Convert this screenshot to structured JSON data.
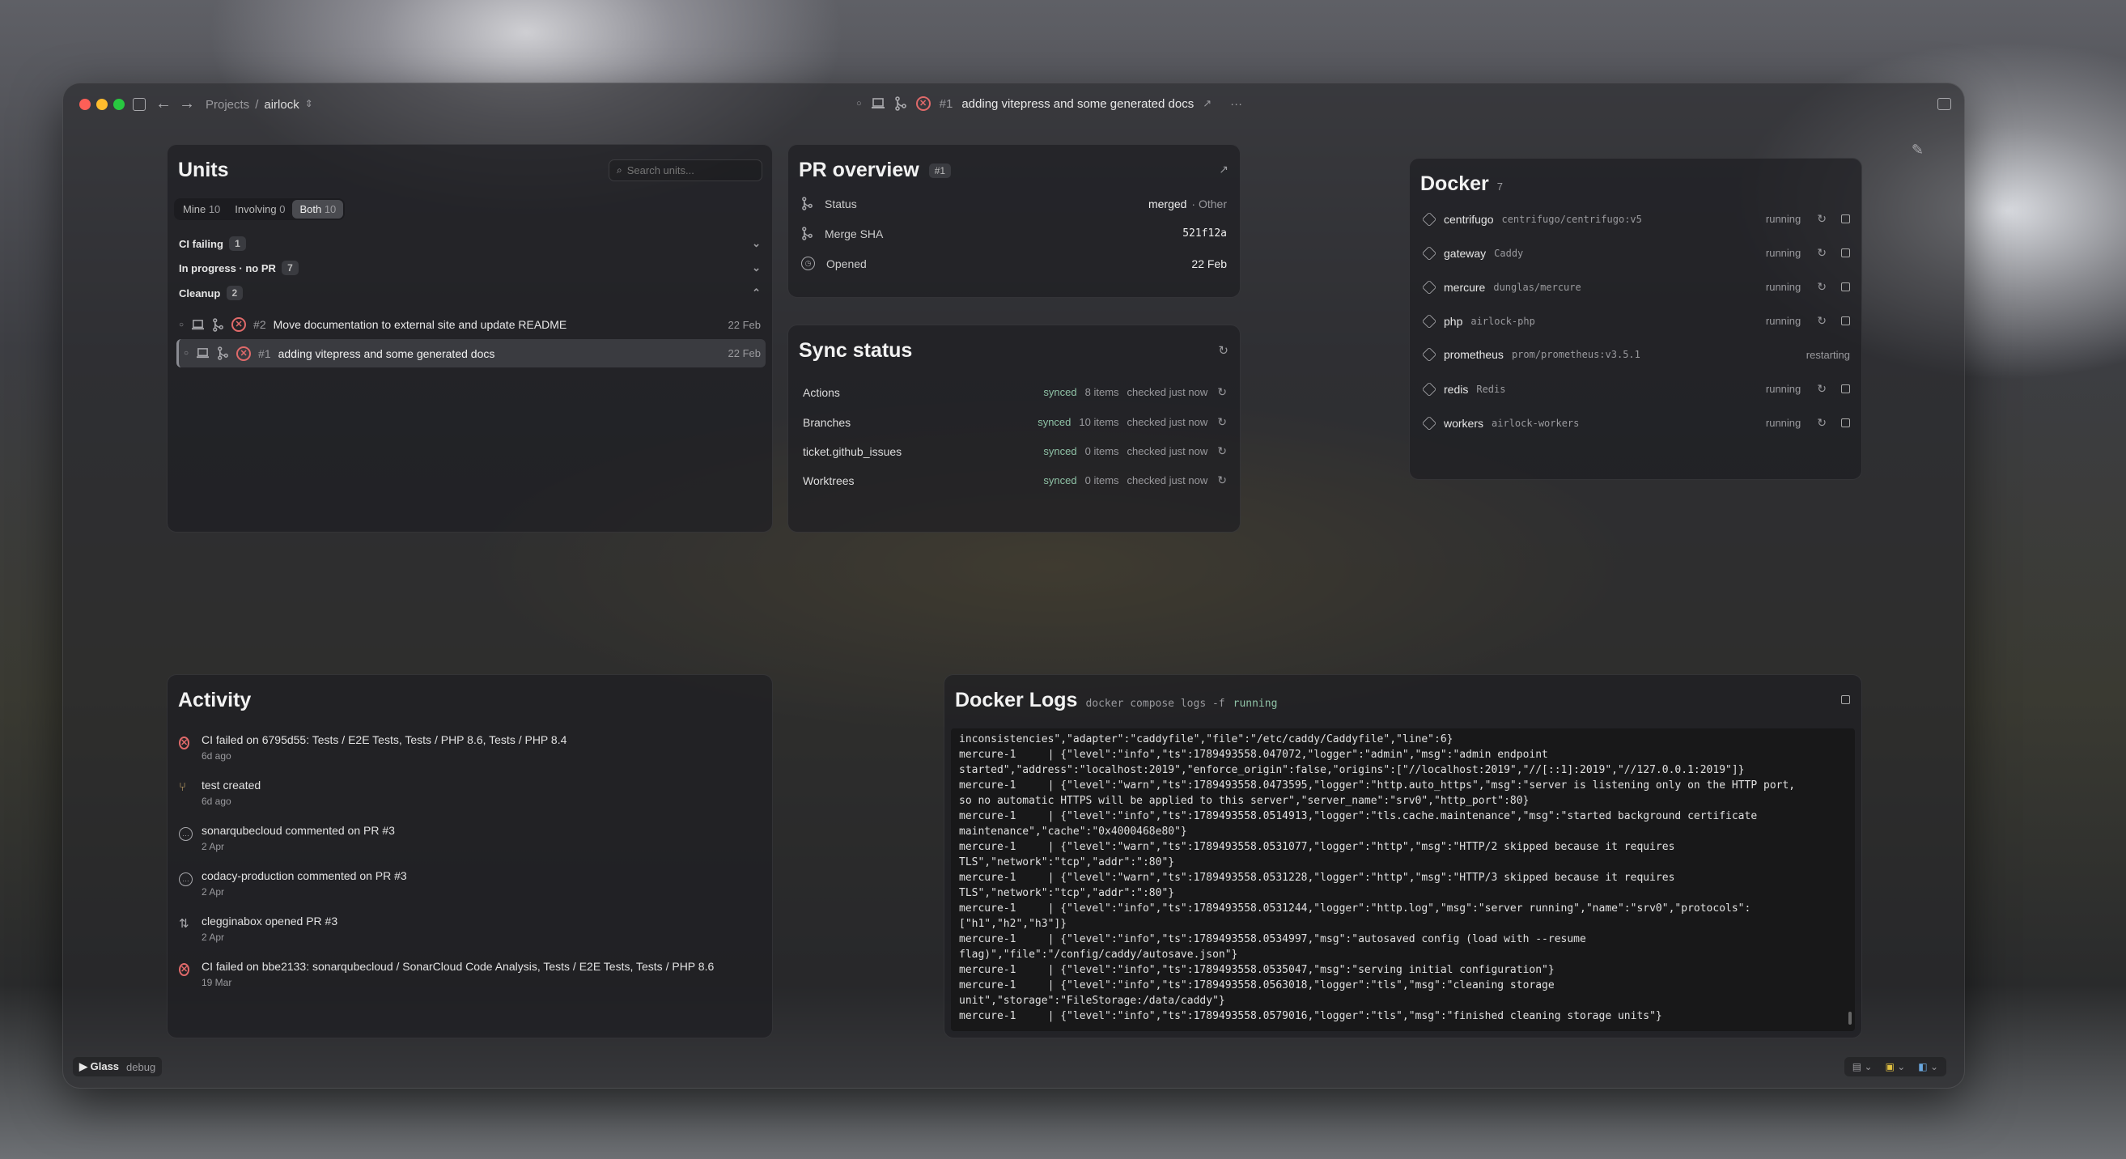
{
  "window": {
    "breadcrumb_root": "Projects",
    "breadcrumb_sep": "/",
    "breadcrumb_project": "airlock",
    "title_pr": "#1",
    "title_text": "adding vitepress and some generated docs"
  },
  "units": {
    "title": "Units",
    "search_placeholder": "Search units...",
    "filters": [
      {
        "label": "Mine",
        "count": "10"
      },
      {
        "label": "Involving",
        "count": "0"
      },
      {
        "label": "Both",
        "count": "10"
      }
    ],
    "groups": [
      {
        "label": "CI failing",
        "count": "1",
        "chevron": "⌄"
      },
      {
        "label": "In progress · no PR",
        "count": "7",
        "chevron": "⌄"
      },
      {
        "label": "Cleanup",
        "count": "2",
        "chevron": "⌃"
      }
    ],
    "items": [
      {
        "num": "#2",
        "title": "Move documentation to external site and update README",
        "date": "22 Feb"
      },
      {
        "num": "#1",
        "title": "adding vitepress and some generated docs",
        "date": "22 Feb"
      }
    ]
  },
  "pr": {
    "title": "PR overview",
    "badge": "#1",
    "rows": [
      {
        "label": "Status",
        "value": "merged",
        "extra": "· Other"
      },
      {
        "label": "Merge SHA",
        "value": "521f12a",
        "extra": ""
      },
      {
        "label": "Opened",
        "value": "22 Feb",
        "extra": ""
      }
    ]
  },
  "sync": {
    "title": "Sync status",
    "rows": [
      {
        "name": "Actions",
        "state": "synced",
        "items": "8 items",
        "checked": "checked just now"
      },
      {
        "name": "Branches",
        "state": "synced",
        "items": "10 items",
        "checked": "checked just now"
      },
      {
        "name": "ticket.github_issues",
        "state": "synced",
        "items": "0 items",
        "checked": "checked just now"
      },
      {
        "name": "Worktrees",
        "state": "synced",
        "items": "0 items",
        "checked": "checked just now"
      }
    ]
  },
  "docker": {
    "title": "Docker",
    "count": "7",
    "containers": [
      {
        "name": "centrifugo",
        "image": "centrifugo/centrifugo:v5",
        "state": "running"
      },
      {
        "name": "gateway",
        "image": "Caddy",
        "state": "running"
      },
      {
        "name": "mercure",
        "image": "dunglas/mercure",
        "state": "running"
      },
      {
        "name": "php",
        "image": "airlock-php",
        "state": "running"
      },
      {
        "name": "prometheus",
        "image": "prom/prometheus:v3.5.1",
        "state": "restarting"
      },
      {
        "name": "redis",
        "image": "Redis",
        "state": "running"
      },
      {
        "name": "workers",
        "image": "airlock-workers",
        "state": "running"
      }
    ]
  },
  "activity": {
    "title": "Activity",
    "items": [
      {
        "icon": "x",
        "text": "CI failed on 6795d55: Tests / E2E Tests, Tests / PHP 8.6, Tests / PHP 8.4",
        "time": "6d ago"
      },
      {
        "icon": "branch",
        "text": "test created",
        "time": "6d ago"
      },
      {
        "icon": "comment",
        "text": "sonarqubecloud commented on PR #3",
        "time": "2 Apr"
      },
      {
        "icon": "comment",
        "text": "codacy-production commented on PR #3",
        "time": "2 Apr"
      },
      {
        "icon": "pr",
        "text": "clegginabox opened PR #3",
        "time": "2 Apr"
      },
      {
        "icon": "x",
        "text": "CI failed on bbe2133: sonarqubecloud / SonarCloud Code Analysis, Tests / E2E Tests, Tests / PHP 8.6",
        "time": "19 Mar"
      }
    ]
  },
  "logs": {
    "title": "Docker Logs",
    "command": "docker compose logs -f",
    "state": "running",
    "lines": [
      "inconsistencies\",\"adapter\":\"caddyfile\",\"file\":\"/etc/caddy/Caddyfile\",\"line\":6}",
      "mercure-1     | {\"level\":\"info\",\"ts\":1789493558.047072,\"logger\":\"admin\",\"msg\":\"admin endpoint",
      "started\",\"address\":\"localhost:2019\",\"enforce_origin\":false,\"origins\":[\"//localhost:2019\",\"//[::1]:2019\",\"//127.0.0.1:2019\"]}",
      "mercure-1     | {\"level\":\"warn\",\"ts\":1789493558.0473595,\"logger\":\"http.auto_https\",\"msg\":\"server is listening only on the HTTP port,",
      "so no automatic HTTPS will be applied to this server\",\"server_name\":\"srv0\",\"http_port\":80}",
      "mercure-1     | {\"level\":\"info\",\"ts\":1789493558.0514913,\"logger\":\"tls.cache.maintenance\",\"msg\":\"started background certificate",
      "maintenance\",\"cache\":\"0x4000468e80\"}",
      "mercure-1     | {\"level\":\"warn\",\"ts\":1789493558.0531077,\"logger\":\"http\",\"msg\":\"HTTP/2 skipped because it requires",
      "TLS\",\"network\":\"tcp\",\"addr\":\":80\"}",
      "mercure-1     | {\"level\":\"warn\",\"ts\":1789493558.0531228,\"logger\":\"http\",\"msg\":\"HTTP/3 skipped because it requires",
      "TLS\",\"network\":\"tcp\",\"addr\":\":80\"}",
      "mercure-1     | {\"level\":\"info\",\"ts\":1789493558.0531244,\"logger\":\"http.log\",\"msg\":\"server running\",\"name\":\"srv0\",\"protocols\":",
      "[\"h1\",\"h2\",\"h3\"]}",
      "mercure-1     | {\"level\":\"info\",\"ts\":1789493558.0534997,\"msg\":\"autosaved config (load with --resume",
      "flag)\",\"file\":\"/config/caddy/autosave.json\"}",
      "mercure-1     | {\"level\":\"info\",\"ts\":1789493558.0535047,\"msg\":\"serving initial configuration\"}",
      "mercure-1     | {\"level\":\"info\",\"ts\":1789493558.0563018,\"logger\":\"tls\",\"msg\":\"cleaning storage",
      "unit\",\"storage\":\"FileStorage:/data/caddy\"}",
      "mercure-1     | {\"level\":\"info\",\"ts\":1789493558.0579016,\"logger\":\"tls\",\"msg\":\"finished cleaning storage units\"}"
    ]
  },
  "footer": {
    "app": "▶ Glass",
    "mode": "debug"
  }
}
